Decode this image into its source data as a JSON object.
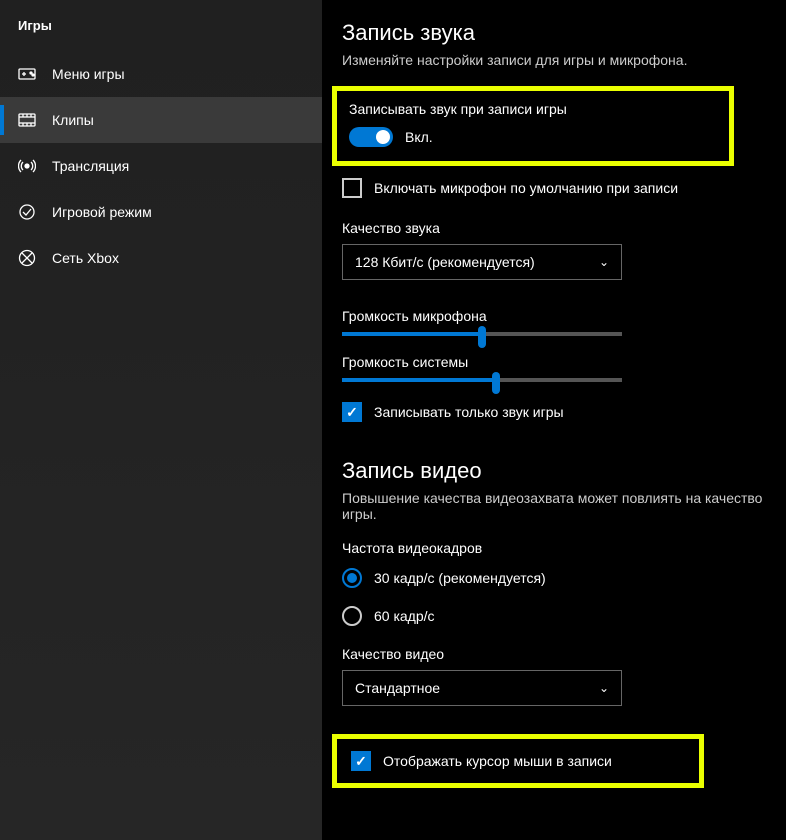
{
  "sidebar": {
    "title": "Игры",
    "items": [
      {
        "label": "Меню игры",
        "icon": "gamebar"
      },
      {
        "label": "Клипы",
        "icon": "clips"
      },
      {
        "label": "Трансляция",
        "icon": "broadcast"
      },
      {
        "label": "Игровой режим",
        "icon": "gamemode"
      },
      {
        "label": "Сеть Xbox",
        "icon": "xbox"
      }
    ]
  },
  "audio": {
    "title": "Запись звука",
    "desc": "Изменяйте настройки записи для игры и микрофона.",
    "recordAudioLabel": "Записывать звук при записи игры",
    "toggleLabel": "Вкл.",
    "micDefaultLabel": "Включать микрофон по умолчанию при записи",
    "qualityLabel": "Качество звука",
    "qualityValue": "128 Кбит/с (рекомендуется)",
    "micVolumeLabel": "Громкость микрофона",
    "sysVolumeLabel": "Громкость системы",
    "gameOnlyLabel": "Записывать только звук игры"
  },
  "video": {
    "title": "Запись видео",
    "desc": "Повышение качества видеозахвата может повлиять на качество игры.",
    "fpsLabel": "Частота видеокадров",
    "fps30": "30 кадр/с (рекомендуется)",
    "fps60": "60 кадр/с",
    "qualityLabel": "Качество видео",
    "qualityValue": "Стандартное",
    "cursorLabel": "Отображать курсор мыши в записи"
  },
  "sliders": {
    "mic": 50,
    "sys": 55
  }
}
